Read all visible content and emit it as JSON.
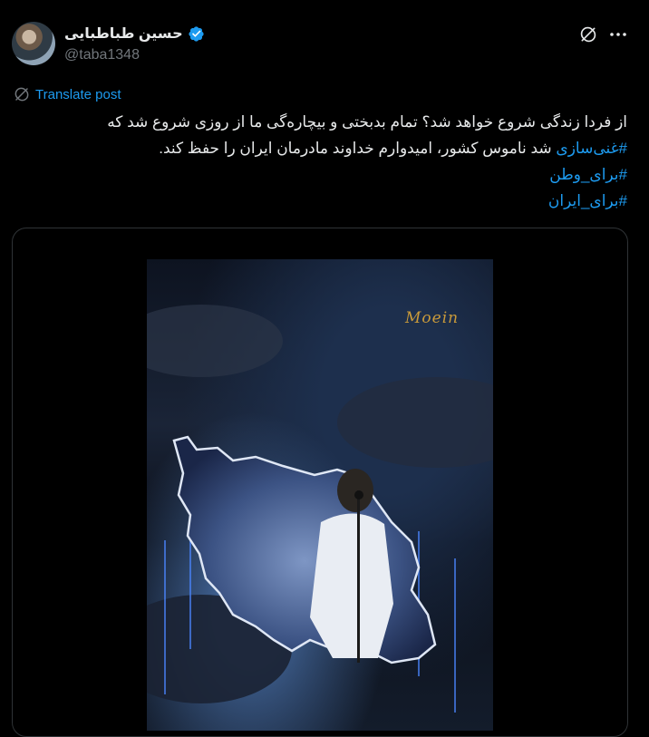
{
  "author": {
    "display_name": "حسین طباطبایی",
    "handle": "@taba1348",
    "verified": true,
    "avatar_icon": "user-avatar"
  },
  "actions": {
    "grok_icon": "grok-icon",
    "more_icon": "more-options-icon"
  },
  "translate": {
    "label": "Translate post",
    "icon": "translate-icon"
  },
  "post": {
    "line1": "از فردا زندگی شروع خواهد شد؟ تمام بدبختی و بیچاره‌گی ما از روزی شروع شد که",
    "line2_hashtag": "#غنی‌سازی",
    "line2_text": " شد ناموس کشور، امیدوارم خداوند مادرمان ایران را حفظ کند.",
    "hashtag2": "#برای_وطن",
    "hashtag3": "#برای_ایران"
  },
  "media": {
    "watermark": "Moein"
  },
  "colors": {
    "background": "#000000",
    "text": "#e7e9ea",
    "secondary": "#71767b",
    "accent": "#1d9bf0"
  }
}
